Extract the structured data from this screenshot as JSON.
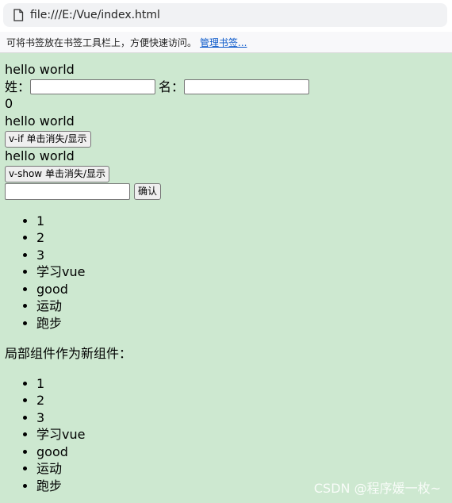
{
  "browser": {
    "url": "file:///E:/Vue/index.html",
    "bookmark_hint": "可将书签放在书签工具栏上，方便快速访问。",
    "bookmark_link": "管理书签..."
  },
  "app": {
    "message": "hello world",
    "last_label": "姓：",
    "first_label": "名：",
    "last_value": "",
    "first_value": "",
    "counter": "0",
    "vif_text": "hello world",
    "vif_button": "v-if 单击消失/显示",
    "vshow_text": "hello world",
    "vshow_button": "v-show 单击消失/显示",
    "todo_input_value": "",
    "confirm_button": "确认",
    "list1": [
      "1",
      "2",
      "3",
      "学习vue",
      "good",
      "运动",
      "跑步"
    ],
    "section_label": "局部组件作为新组件：",
    "list2": [
      "1",
      "2",
      "3",
      "学习vue",
      "good",
      "运动",
      "跑步"
    ]
  },
  "watermark": "CSDN @程序媛一枚~",
  "icons": {
    "page": "file-icon",
    "bullet": "disc-bullet"
  },
  "colors": {
    "background": "#cde8d0",
    "link": "#0a58ca"
  }
}
